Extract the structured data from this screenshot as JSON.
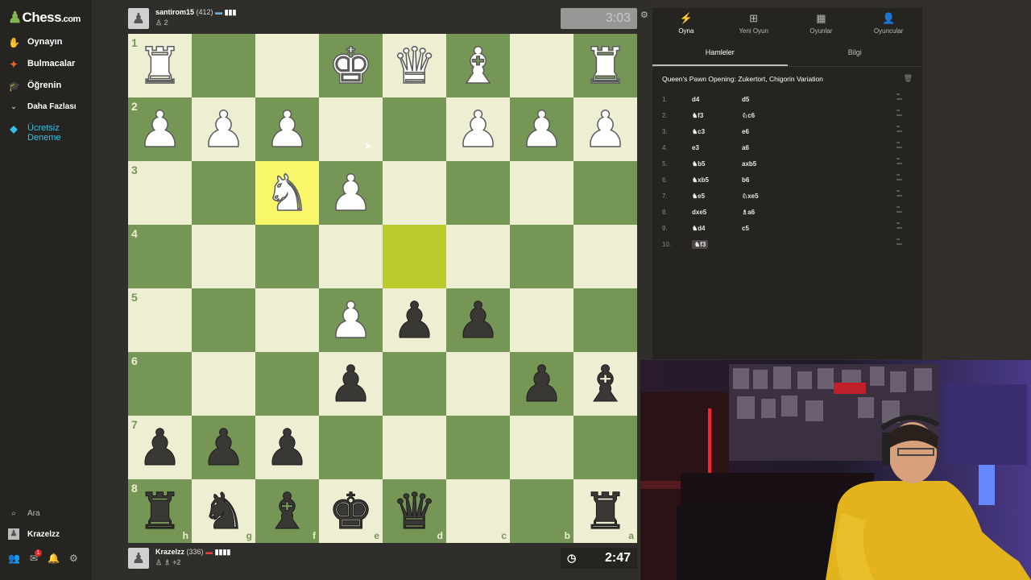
{
  "brand": {
    "name": "Chess",
    "tld": ".com"
  },
  "nav": {
    "items": [
      {
        "label": "Oynayın",
        "icon": "play-hand-icon"
      },
      {
        "label": "Bulmacalar",
        "icon": "puzzle-icon"
      },
      {
        "label": "Öğrenin",
        "icon": "learn-icon"
      },
      {
        "label": "Daha Fazlası",
        "icon": "chevron-down-icon"
      },
      {
        "label": "Ücretsiz Deneme",
        "icon": "diamond-icon"
      }
    ],
    "search_label": "Ara",
    "user_label": "Krazelzz",
    "notification_count": "1"
  },
  "top_player": {
    "name": "santirom15",
    "rating": "(412)",
    "sub": "♙ 2",
    "clock": "3:03"
  },
  "bottom_player": {
    "name": "Krazelzz",
    "rating": "(336)",
    "sub": "♙ ♗ +2",
    "clock": "2:47"
  },
  "board": {
    "ranks": [
      "1",
      "2",
      "3",
      "4",
      "5",
      "6",
      "7",
      "8"
    ],
    "files": [
      "h",
      "g",
      "f",
      "e",
      "d",
      "c",
      "b",
      "a"
    ],
    "rows": [
      [
        "wR",
        "",
        "",
        "wK",
        "wQ",
        "wB",
        "",
        "wR"
      ],
      [
        "wP",
        "wP",
        "wP",
        "",
        "",
        "wP",
        "wP",
        "wP"
      ],
      [
        "",
        "",
        "wN",
        "wP",
        "",
        "",
        "",
        ""
      ],
      [
        "",
        "",
        "",
        "",
        "",
        "",
        "",
        ""
      ],
      [
        "",
        "",
        "",
        "wP",
        "bP",
        "bP",
        "",
        ""
      ],
      [
        "",
        "",
        "",
        "bP",
        "",
        "",
        "bP",
        "bB"
      ],
      [
        "bP",
        "bP",
        "bP",
        "",
        "",
        "",
        "",
        ""
      ],
      [
        "bR",
        "bN",
        "bB",
        "bK",
        "bQ",
        "",
        "",
        "bR"
      ]
    ],
    "highlights": [
      [
        2,
        2
      ],
      [
        3,
        4
      ]
    ]
  },
  "panel": {
    "tabs": [
      {
        "label": "Oyna",
        "icon": "lightning-icon"
      },
      {
        "label": "Yeni Oyun",
        "icon": "plus-square-icon"
      },
      {
        "label": "Oyunlar",
        "icon": "board-icon"
      },
      {
        "label": "Oyuncular",
        "icon": "players-icon"
      }
    ],
    "subtabs": [
      "Hamleler",
      "Bilgi"
    ],
    "opening": "Queen's Pawn Opening: Zukertort, Chigorin Variation",
    "moves": [
      {
        "num": "1.",
        "white": "d4",
        "black": "d5"
      },
      {
        "num": "2.",
        "white": "♞f3",
        "black": "♘c6"
      },
      {
        "num": "3.",
        "white": "♞c3",
        "black": "e6"
      },
      {
        "num": "4.",
        "white": "e3",
        "black": "a6"
      },
      {
        "num": "5.",
        "white": "♞b5",
        "black": "axb5"
      },
      {
        "num": "6.",
        "white": "♞xb5",
        "black": "b6"
      },
      {
        "num": "7.",
        "white": "♞e5",
        "black": "♘xe5"
      },
      {
        "num": "8.",
        "white": "dxe5",
        "black": "♗a6"
      },
      {
        "num": "9.",
        "white": "♞d4",
        "black": "c5"
      },
      {
        "num": "10.",
        "white": "♞f3",
        "black": ""
      }
    ]
  }
}
